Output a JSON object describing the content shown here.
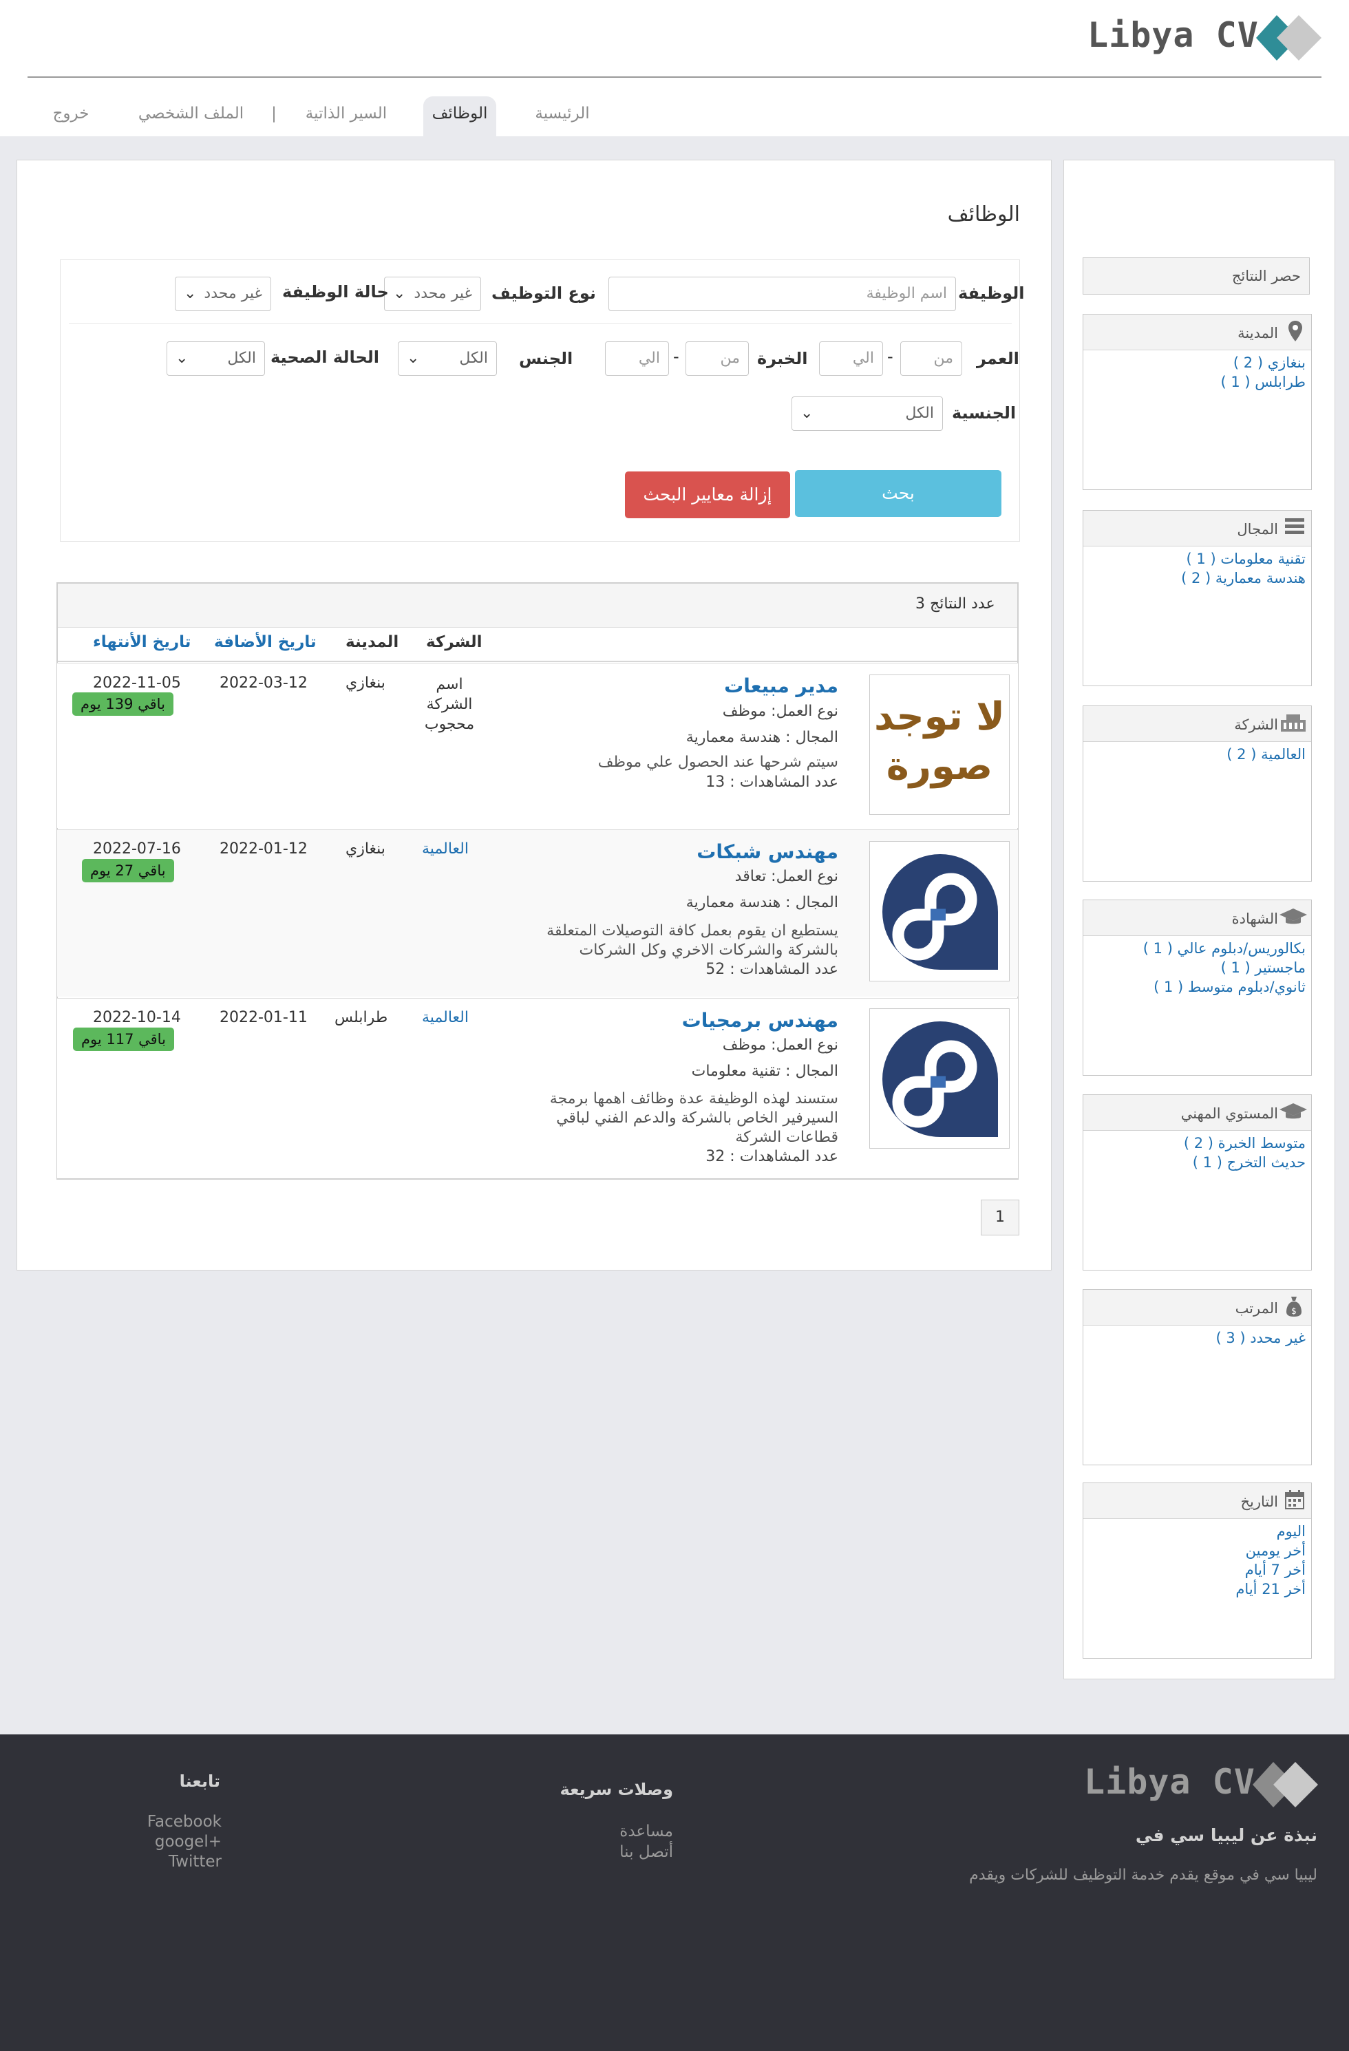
{
  "header": {
    "logo_text": "Libya CV",
    "nav": {
      "home": "الرئيسية",
      "jobs": "الوظائف",
      "cvs": "السير الذاتية",
      "separator": "|",
      "profile": "الملف الشخصي",
      "logout": "خروج"
    }
  },
  "sidebar": {
    "title": "حصر النتائج",
    "city": {
      "title": "المدينة",
      "icon": "map-pin-icon",
      "items": [
        "بنغازي ( 2 )",
        "طرابلس ( 1 )"
      ]
    },
    "field": {
      "title": "المجال",
      "icon": "list-icon",
      "items": [
        "تقنية معلومات ( 1 )",
        "هندسة معمارية ( 2 )"
      ]
    },
    "company": {
      "title": "الشركة",
      "icon": "building-icon",
      "items": [
        "العالمية ( 2 )"
      ]
    },
    "degree": {
      "title": "الشهادة",
      "icon": "graduation-cap-icon",
      "items": [
        "بكالوريس/دبلوم عالي ( 1 )",
        "ماجستير ( 1 )",
        "ثانوي/دبلوم متوسط ( 1 )"
      ]
    },
    "level": {
      "title": "المستوي المهني",
      "icon": "graduation-cap-icon",
      "items": [
        "متوسط الخبرة ( 2 )",
        "حديث التخرج ( 1 )"
      ]
    },
    "salary": {
      "title": "المرتب",
      "icon": "money-bag-icon",
      "items": [
        "غير محدد ( 3 )"
      ]
    },
    "date": {
      "title": "التاريخ",
      "icon": "calendar-icon",
      "items": [
        "اليوم",
        "أخر يومين",
        "أخر 7 أيام",
        "أخر 21 أيام"
      ]
    }
  },
  "main": {
    "title": "الوظائف",
    "search": {
      "job_label": "الوظيفة",
      "job_placeholder": "اسم الوظيفة",
      "employment_type_label": "نوع التوظيف",
      "employment_type_value": "غير محدد",
      "job_status_label": "حالة الوظيفة",
      "job_status_value": "غير محدد",
      "age_label": "العمر",
      "age_from": "من",
      "age_to": "الي",
      "experience_label": "الخبرة",
      "experience_from": "من",
      "experience_to": "الي",
      "dash": "-",
      "gender_label": "الجنس",
      "gender_value": "الكل",
      "health_label": "الحالة الصحية",
      "health_value": "الكل",
      "nationality_label": "الجنسية",
      "nationality_value": "الكل",
      "search_button": "بحث",
      "clear_button": "إزالة معايير البحث"
    },
    "results": {
      "count_label": "عدد النتائج 3",
      "columns": {
        "company": "الشركة",
        "city": "المدينة",
        "added": "تاريخ الأضافة",
        "expiry": "تاريخ الأنتهاء"
      },
      "rows": [
        {
          "image": "no-image",
          "no_image_text_1": "لا توجد",
          "no_image_text_2": "صورة",
          "title": "مدير مبيعات",
          "work_type": "نوع العمل: موظف",
          "field": "المجال : هندسة معمارية",
          "desc_1": "سيتم شرحها عند الحصول علي موظف",
          "desc_2": "",
          "desc_3": "",
          "views": "عدد المشاهدات : 13",
          "company_1": "اسم",
          "company_2": "الشركة",
          "company_3": "محجوب",
          "city": "بنغازي",
          "added": "2022-03-12",
          "expiry": "2022-11-05",
          "remaining": "باقي 139 يوم"
        },
        {
          "image": "fedora-logo",
          "title": "مهندس شبكات",
          "work_type": "نوع العمل: تعاقد",
          "field": "المجال : هندسة معمارية",
          "desc_1": "يستطيع ان يقوم بعمل كافة التوصيلات المتعلقة",
          "desc_2": "بالشركة والشركات الاخري وكل الشركات",
          "desc_3": "",
          "views": "عدد المشاهدات : 52",
          "company_1": "العالمية",
          "city": "بنغازي",
          "added": "2022-01-12",
          "expiry": "2022-07-16",
          "remaining": "باقي 27 يوم"
        },
        {
          "image": "fedora-logo",
          "title": "مهندس برمجيات",
          "work_type": "نوع العمل: موظف",
          "field": "المجال : تقنية معلومات",
          "desc_1": "ستسند لهذه الوظيفة عدة وظائف اهمها برمجة",
          "desc_2": "السيرفير الخاص بالشركة والدعم الفني لباقي",
          "desc_3": "قطاعات الشركة",
          "views": "عدد المشاهدات : 32",
          "company_1": "العالمية",
          "city": "طرابلس",
          "added": "2022-01-11",
          "expiry": "2022-10-14",
          "remaining": "باقي 117 يوم"
        }
      ]
    },
    "pagination": {
      "current": "1"
    }
  },
  "footer": {
    "logo_text": "Libya CV",
    "about_title": "نبذة عن ليبيا سي في",
    "about_text": "ليبيا سي في موقع يقدم خدمة التوظيف للشركات ويقدم",
    "quick_links_title": "وصلات سريعة",
    "quick_links": [
      "مساعدة",
      "أتصل بنا"
    ],
    "follow_title": "تابعنا",
    "follow_links": [
      "Facebook",
      "googel+",
      "Twitter"
    ]
  },
  "colors": {
    "accent_blue": "#1e6fb0",
    "search_button": "#5bc0de",
    "clear_button": "#d9534f",
    "badge_green": "#5cb85c",
    "footer_bg": "#303138",
    "logo_teal": "#2f8d97",
    "logo_grey": "#c9c9c9",
    "fedora_blue": "#294172",
    "fedora_light": "#3c6eb4",
    "no_image_brown": "#8a5a1c"
  }
}
